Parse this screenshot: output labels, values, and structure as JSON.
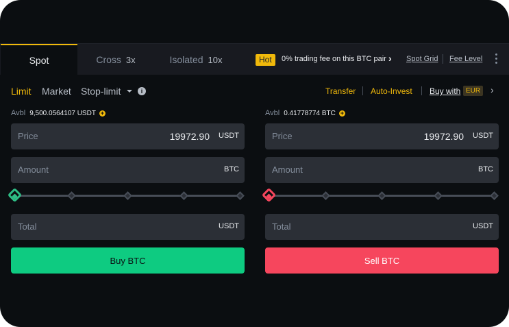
{
  "tabs": {
    "spot": "Spot",
    "cross": "Cross",
    "cross_leverage": "3x",
    "isolated": "Isolated",
    "isolated_leverage": "10x"
  },
  "promo": {
    "badge": "Hot",
    "text": "0% trading fee on this BTC pair",
    "arrow": "›"
  },
  "toolbar_links": {
    "spot_grid": "Spot Grid",
    "fee_level": "Fee Level"
  },
  "order_types": {
    "limit": "Limit",
    "market": "Market",
    "stop_limit": "Stop-limit",
    "info_glyph": "i"
  },
  "right_links": {
    "transfer": "Transfer",
    "auto_invest": "Auto-Invest",
    "buy_with": "Buy with",
    "currency": "EUR",
    "arrow": "›"
  },
  "buy_form": {
    "avbl_label": "Avbl",
    "avbl_value": "9,500.0564107 USDT",
    "price_label": "Price",
    "price_value": "19972.90",
    "price_unit": "USDT",
    "amount_label": "Amount",
    "amount_unit": "BTC",
    "total_label": "Total",
    "total_unit": "USDT",
    "slider_percent": 0,
    "button": "Buy BTC"
  },
  "sell_form": {
    "avbl_label": "Avbl",
    "avbl_value": "0.41778774 BTC",
    "price_label": "Price",
    "price_value": "19972.90",
    "price_unit": "USDT",
    "amount_label": "Amount",
    "amount_unit": "BTC",
    "total_label": "Total",
    "total_unit": "USDT",
    "slider_percent": 0,
    "button": "Sell BTC"
  },
  "colors": {
    "accent": "#f0b90b",
    "buy": "#0ecb81",
    "sell": "#f6465d",
    "background": "#0b0e11",
    "panel": "#2b2f36"
  },
  "icons": [
    "info-icon",
    "add-funds-icon",
    "chevron-right-icon",
    "more-icon",
    "dropdown-caret-icon",
    "slider-handle-icon"
  ]
}
